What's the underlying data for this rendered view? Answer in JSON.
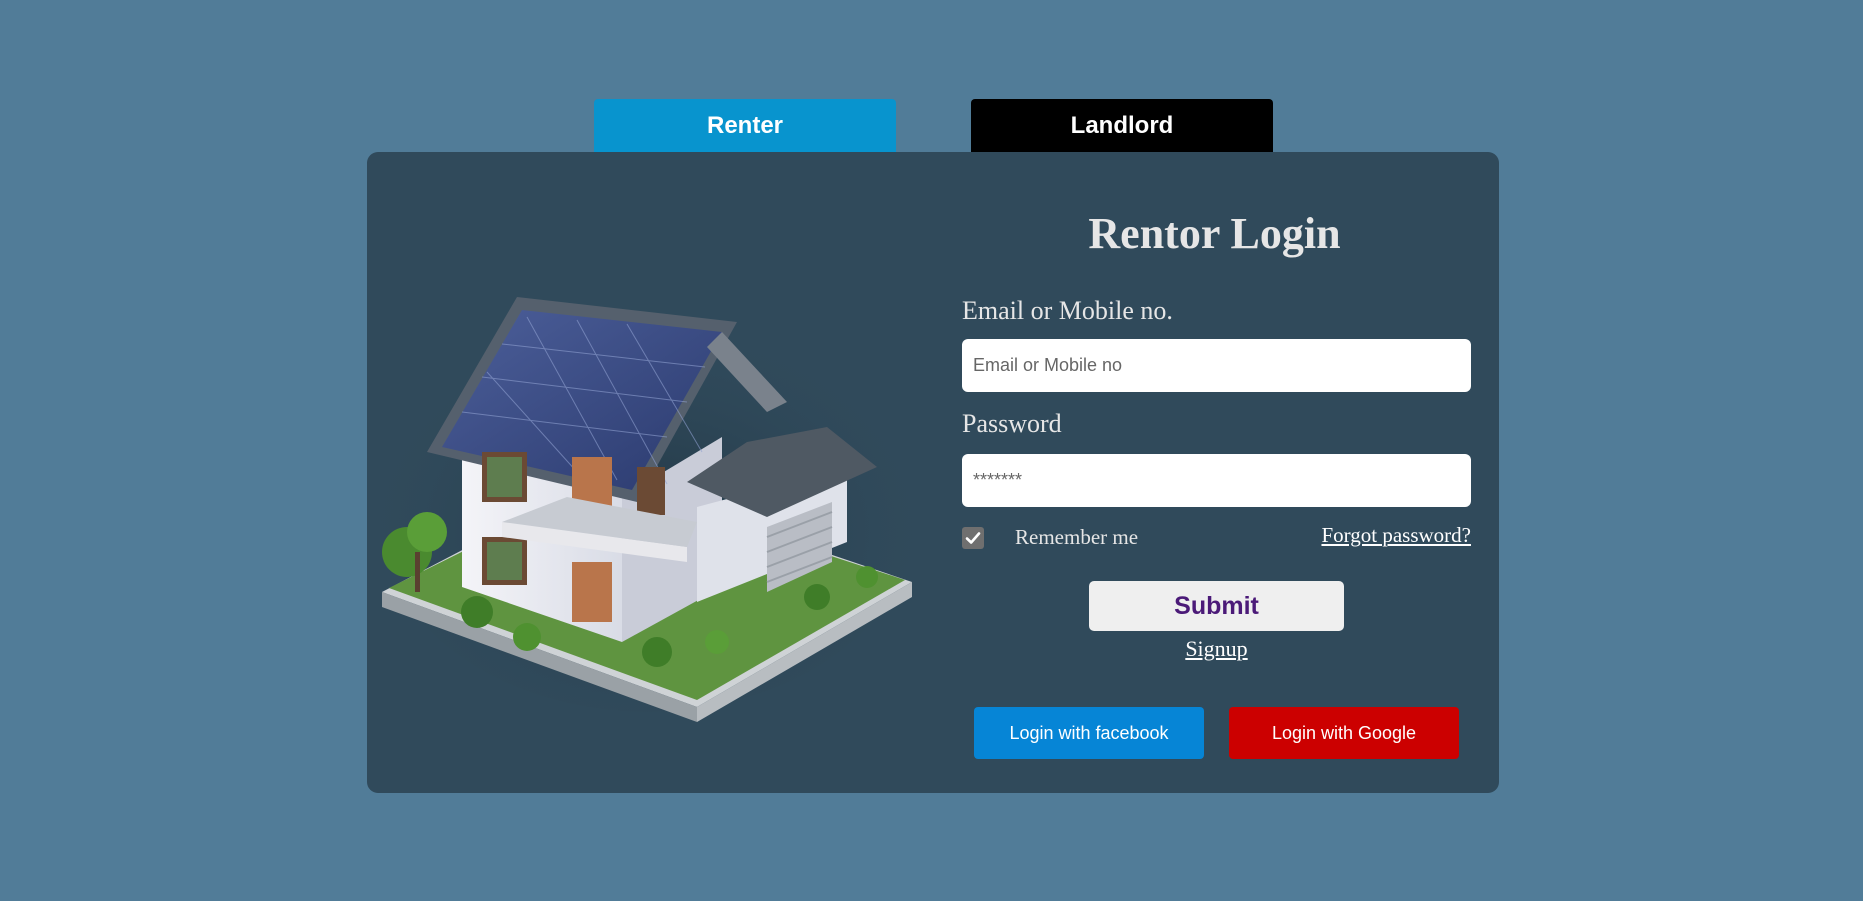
{
  "tabs": {
    "renter": "Renter",
    "landlord": "Landlord"
  },
  "login": {
    "title": "Rentor Login",
    "email_label": "Email or Mobile no.",
    "email_placeholder": "Email or Mobile no",
    "password_label": "Password",
    "password_placeholder": "*******",
    "remember_label": "Remember me",
    "remember_checked": true,
    "forgot_label": "Forgot password?",
    "submit_label": "Submit",
    "signup_label": "Signup"
  },
  "social": {
    "facebook_label": "Login with facebook",
    "google_label": "Login with Google"
  },
  "colors": {
    "page_background": "#517c98",
    "card_background": "#304a5b",
    "renter_tab": "#0894ce",
    "landlord_tab": "#000000",
    "submit_text": "#4b1a78",
    "facebook": "#0685d6",
    "google": "#cc0000"
  },
  "icons": {
    "house_illustration": "house-illustration",
    "checkbox": "checkmark-icon"
  }
}
